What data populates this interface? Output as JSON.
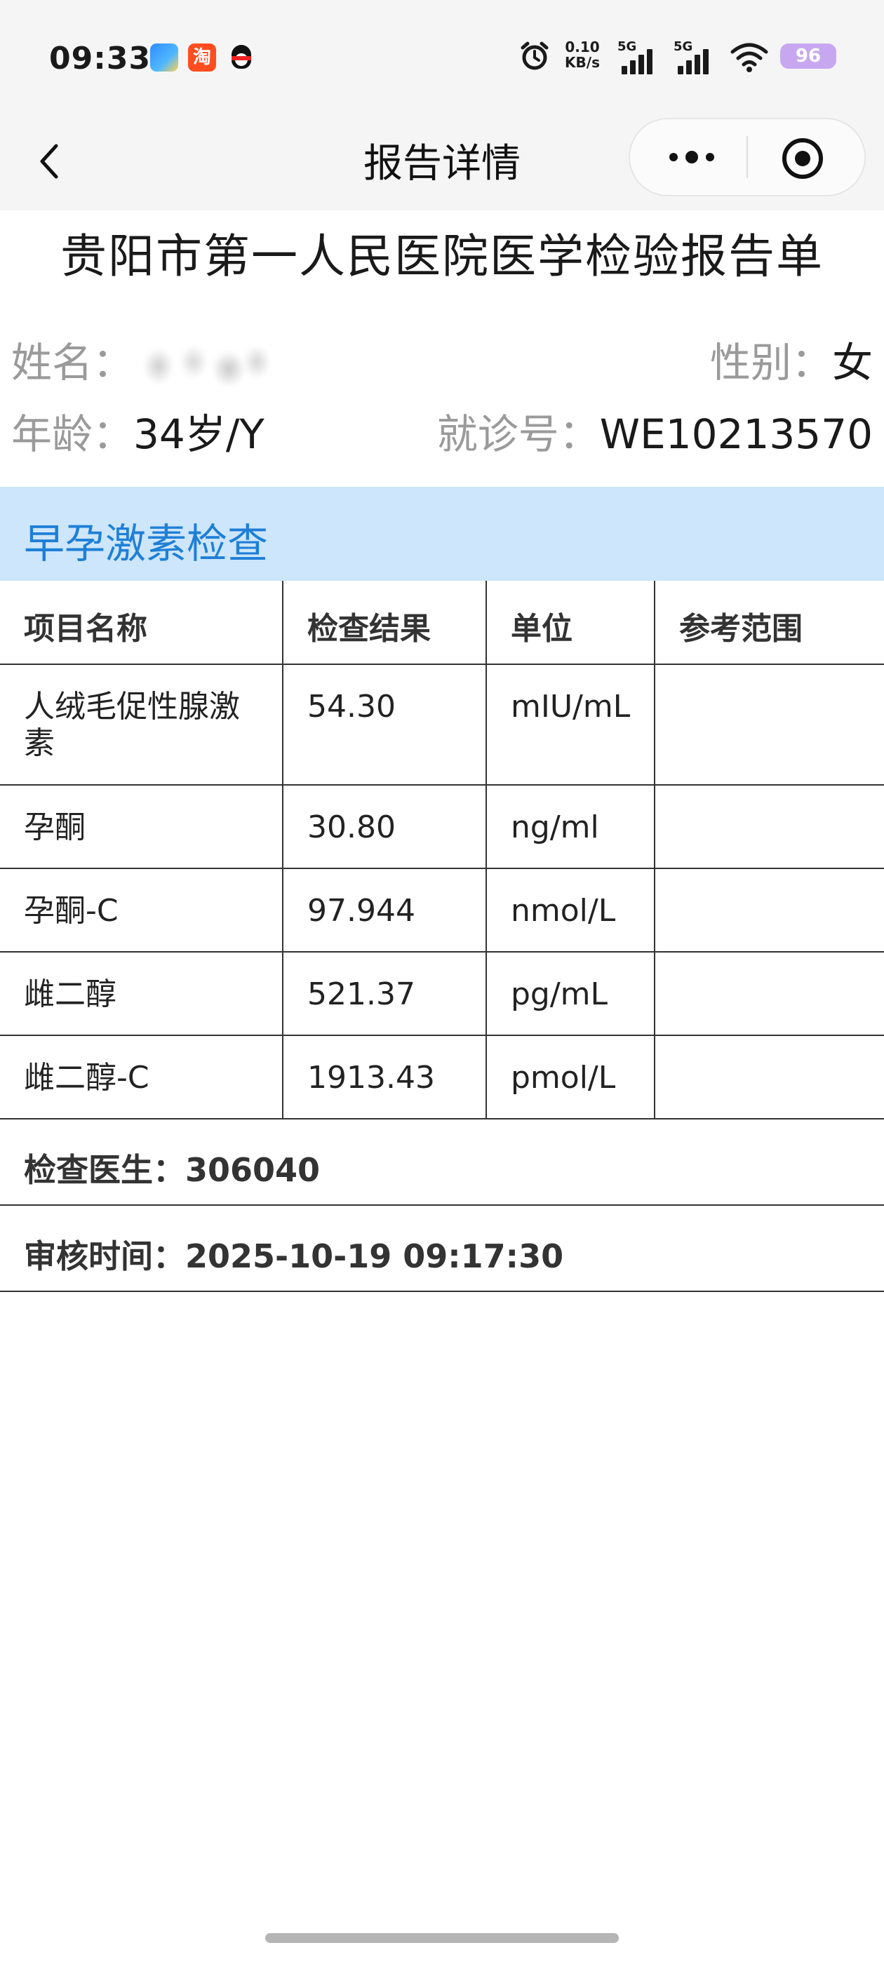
{
  "status_bar": {
    "time": "09:33",
    "taobao_icon_text": "淘",
    "network_speed": [
      "0.10",
      "KB/s"
    ],
    "signal_1_label": "5G",
    "signal_2_label": "5G",
    "battery": "96",
    "icons": [
      "app-icon",
      "taobao-icon",
      "qq-icon",
      "alarm-icon",
      "signal-icon",
      "wifi-icon",
      "battery-icon"
    ]
  },
  "nav": {
    "title": "报告详情",
    "icons": [
      "back-icon",
      "more-icon",
      "target-icon"
    ]
  },
  "report": {
    "title": "贵阳市第一人民医院医学检验报告单",
    "name_label": "姓名：",
    "gender_label": "性别：",
    "gender_value": "女",
    "age_label": "年龄：",
    "age_value": "34岁/Y",
    "visit_label": "就诊号：",
    "visit_value": "WE10213570"
  },
  "section": {
    "title": "早孕激素检查"
  },
  "table": {
    "headers": [
      "项目名称",
      "检查结果",
      "单位",
      "参考范围"
    ],
    "rows": [
      [
        "人绒毛促性腺激素",
        "54.30",
        "mIU/mL",
        ""
      ],
      [
        "孕酮",
        "30.80",
        "ng/ml",
        ""
      ],
      [
        "孕酮-C",
        "97.944",
        "nmol/L",
        ""
      ],
      [
        "雌二醇",
        "521.37",
        "pg/mL",
        ""
      ],
      [
        "雌二醇-C",
        "1913.43",
        "pmol/L",
        ""
      ]
    ]
  },
  "footer": {
    "doctor": "检查医生：306040",
    "review_time": "审核时间：2025-10-19 09:17:30"
  },
  "colors": {
    "section_bg": "#cde6fb",
    "section_text": "#1f7fd6",
    "label_gray": "#9a9a9a",
    "battery": "#c7a8f0"
  }
}
